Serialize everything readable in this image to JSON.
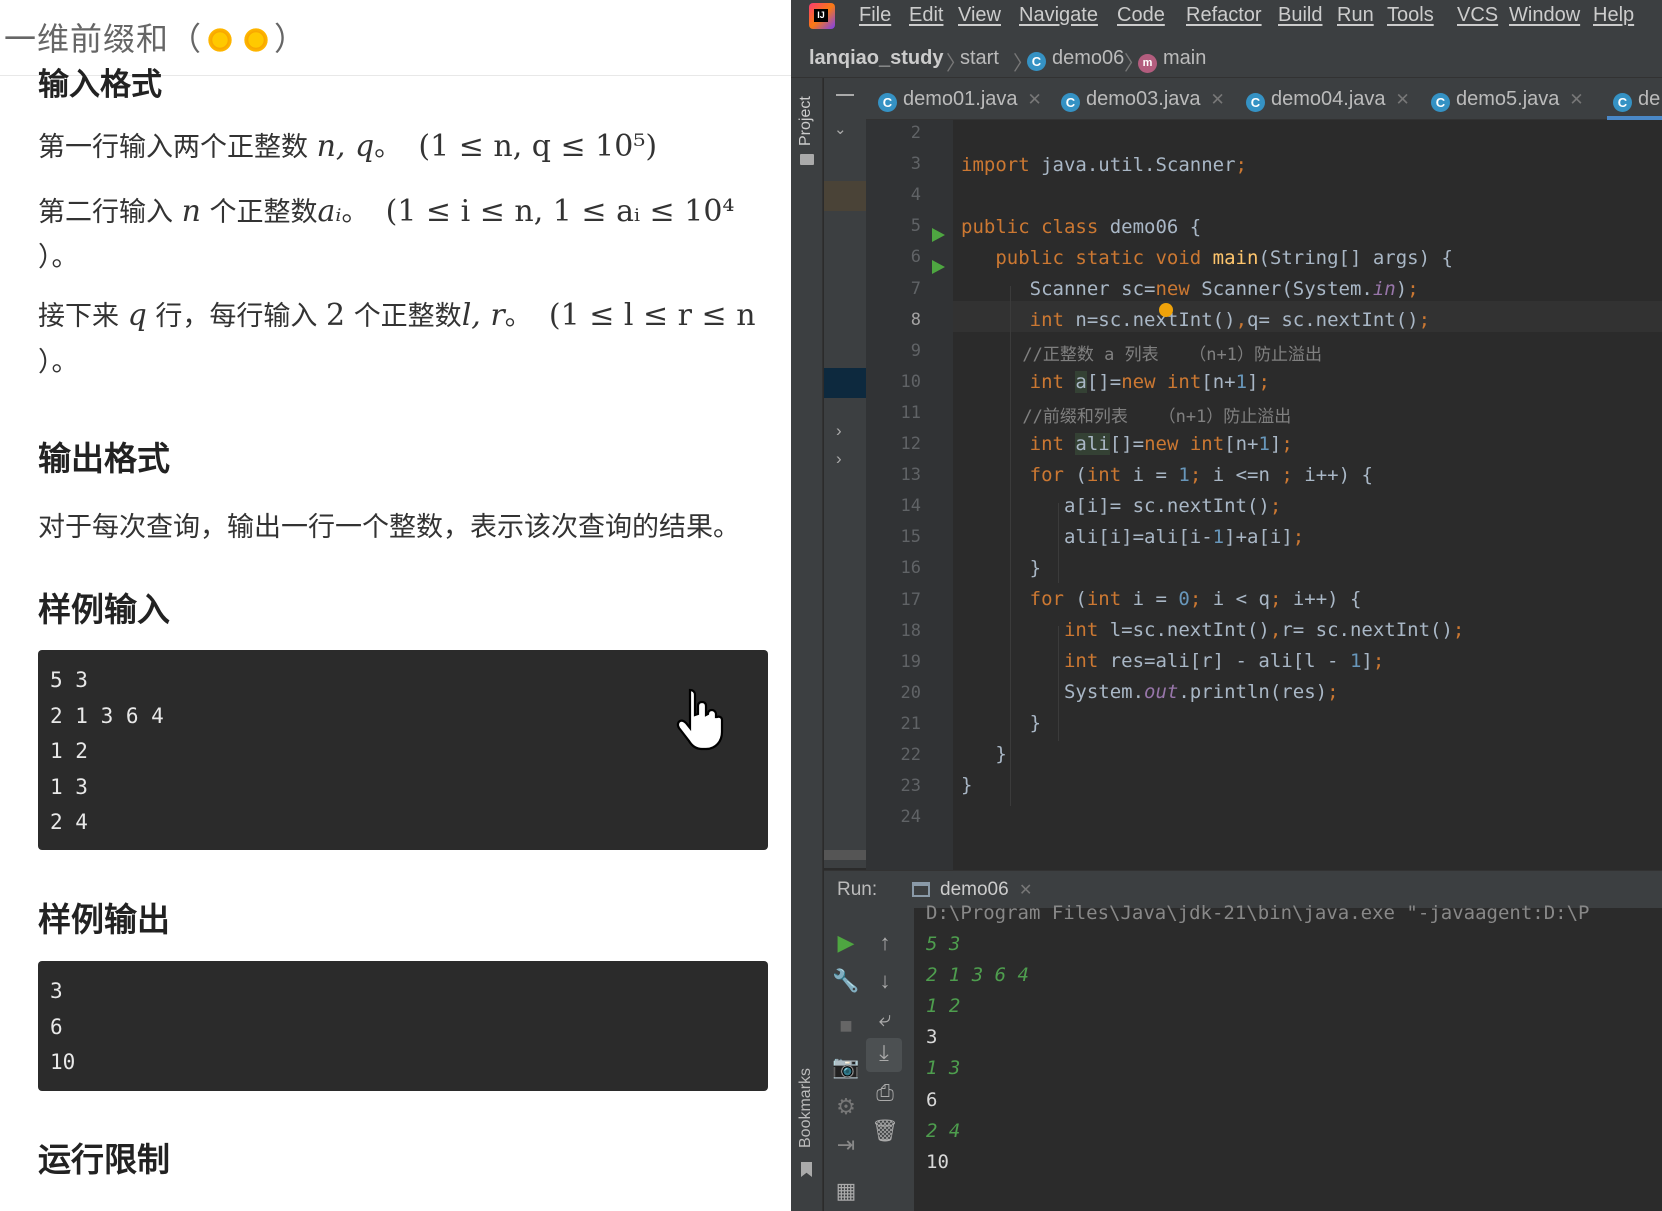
{
  "problem": {
    "title": "一维前缀和（",
    "title_end": "）",
    "cut_heading": "输入格式",
    "line1_text": "第一行输入两个正整数",
    "line1_math": "n, q",
    "line1_sep": "。",
    "line1_range": "(1 ≤ n, q ≤ 10⁵)",
    "line2_text": "第二行输入",
    "line2_var": "n",
    "line2_text2": "个正整数",
    "line2_var2": "aᵢ",
    "line2_sep": "。",
    "line2_range": "(1 ≤ i ≤ n, 1 ≤ aᵢ ≤ 10⁴",
    "line2_tail": "）。",
    "line3_text": "接下来",
    "line3_var": "q",
    "line3_text2": "行，每行输入",
    "line3_num": "2",
    "line3_text3": "个正整数",
    "line3_var2": "l, r",
    "line3_sep": "。",
    "line3_range": "(1 ≤ l ≤ r ≤ n",
    "line3_tail": "）。",
    "output_heading": "输出格式",
    "output_desc": "对于每次查询，输出一行一个整数，表示该次查询的结果。",
    "sample_in_heading": "样例输入",
    "sample_in": [
      "5 3",
      "2 1 3 6 4",
      "1 2",
      "1 3",
      "2 4"
    ],
    "sample_out_heading": "样例输出",
    "sample_out": [
      "3",
      "6",
      "10"
    ],
    "limit_heading": "运行限制"
  },
  "ide": {
    "menu": [
      "File",
      "Edit",
      "View",
      "Navigate",
      "Code",
      "Refactor",
      "Build",
      "Run",
      "Tools",
      "VCS",
      "Window",
      "Help"
    ],
    "breadcrumb": {
      "project": "lanqiao_study",
      "folder": "start",
      "class": "demo06",
      "method": "main"
    },
    "tabs": [
      "demo01.java",
      "demo03.java",
      "demo04.java",
      "demo5.java",
      "de"
    ],
    "side_labels": {
      "project": "Project",
      "bookmarks": "Bookmarks"
    },
    "run_label": "Run:",
    "run_tab": "demo06",
    "console_cmd": "D:\\Program Files\\Java\\jdk-21\\bin\\java.exe \"-javaagent:D:\\P",
    "console": [
      {
        "text": "5 3",
        "input": true
      },
      {
        "text": "2 1 3 6 4",
        "input": true
      },
      {
        "text": "1 2",
        "input": true
      },
      {
        "text": "3",
        "input": false
      },
      {
        "text": "1 3",
        "input": true
      },
      {
        "text": "6",
        "input": false
      },
      {
        "text": "2 4",
        "input": true
      },
      {
        "text": "10",
        "input": false
      }
    ],
    "code": {
      "import_kw": "import",
      "import_pkg": " java.util.Scanner",
      "class_decl": "demo06",
      "main_sig": "(String[] args) {",
      "l7": "Scanner sc=",
      "l8": "int",
      "c9": "//正整数 a 列表   （n+1）防止溢出",
      "c11": "//前缀和列表   （n+1）防止溢出"
    }
  },
  "colors": {
    "ide_bg": "#2b2b2b",
    "keyword": "#cc7832",
    "method": "#ffc66d",
    "number": "#6897bb",
    "comment": "#808080",
    "input_text": "#4e9e4e"
  }
}
